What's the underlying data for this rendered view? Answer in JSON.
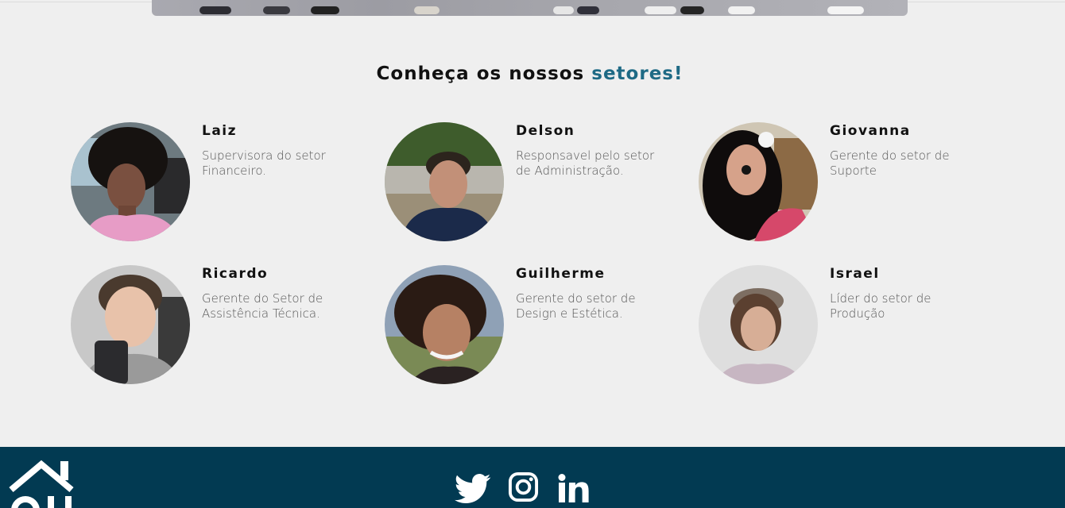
{
  "section": {
    "title_prefix": "Conheça os nossos ",
    "title_accent": "setores!"
  },
  "members": [
    {
      "name": "Laiz",
      "role": "Supervisora do setor Financeiro."
    },
    {
      "name": "Delson",
      "role": "Responsavel pelo setor de Administração."
    },
    {
      "name": "Giovanna",
      "role": "Gerente do setor de Suporte"
    },
    {
      "name": "Ricardo",
      "role": "Gerente do Setor de Assistência Técnica."
    },
    {
      "name": "Guilherme",
      "role": "Gerente do setor de Design e Estética."
    },
    {
      "name": "Israel",
      "role": "Líder do setor de Produção"
    }
  ],
  "footer": {
    "social_icons": [
      "twitter-icon",
      "instagram-icon",
      "linkedin-icon"
    ],
    "background": "#023a52"
  },
  "colors": {
    "accent": "#1e6a85",
    "page_bg": "#efefef"
  }
}
